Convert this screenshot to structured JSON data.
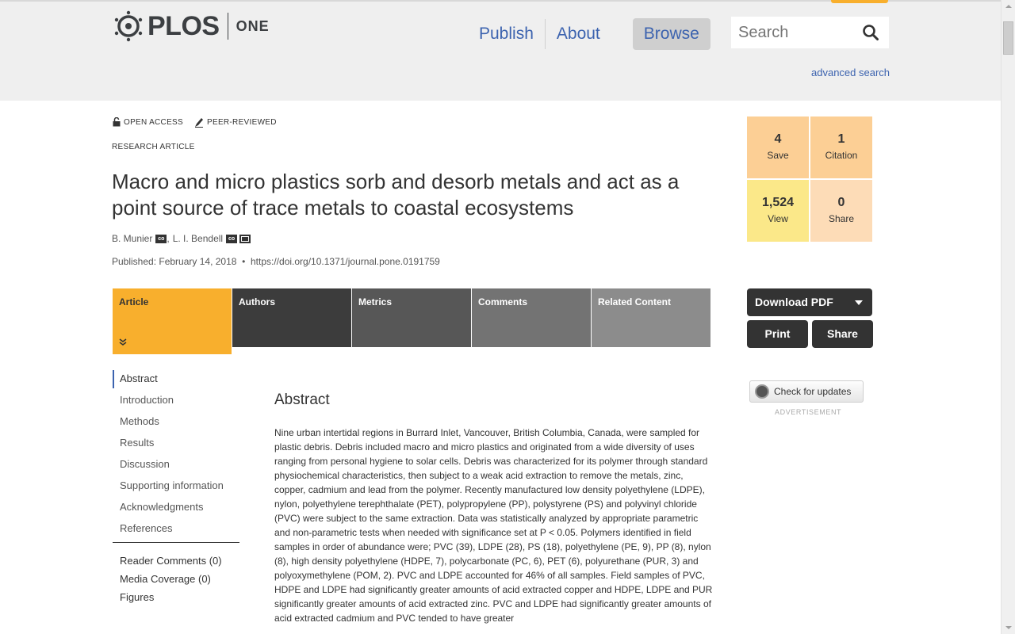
{
  "header": {
    "logo_text": "PLOS",
    "logo_sub": "ONE",
    "nav": [
      {
        "label": "Publish"
      },
      {
        "label": "About"
      },
      {
        "label": "Browse"
      }
    ],
    "search_placeholder": "Search",
    "advanced_search": "advanced search"
  },
  "article": {
    "badges": {
      "open_access": "OPEN ACCESS",
      "peer_reviewed": "PEER-REVIEWED"
    },
    "type": "RESEARCH ARTICLE",
    "title": "Macro and micro plastics sorb and desorb metals and act as a point source of trace metals to coastal ecosystems",
    "authors": [
      {
        "name": "B. Munier"
      },
      {
        "name": "L. I. Bendell"
      }
    ],
    "author_badge": "co",
    "published": "Published: February 14, 2018",
    "doi": "https://doi.org/10.1371/journal.pone.0191759"
  },
  "metrics": {
    "save": {
      "value": "4",
      "label": "Save"
    },
    "citation": {
      "value": "1",
      "label": "Citation"
    },
    "view": {
      "value": "1,524",
      "label": "View"
    },
    "share": {
      "value": "0",
      "label": "Share"
    }
  },
  "tabs": [
    {
      "label": "Article"
    },
    {
      "label": "Authors"
    },
    {
      "label": "Metrics"
    },
    {
      "label": "Comments"
    },
    {
      "label": "Related Content"
    }
  ],
  "actions": {
    "download": "Download PDF",
    "print": "Print",
    "share": "Share",
    "check_updates": "Check for updates",
    "advertisement": "ADVERTISEMENT"
  },
  "sidenav": {
    "sections": [
      "Abstract",
      "Introduction",
      "Methods",
      "Results",
      "Discussion",
      "Supporting information",
      "Acknowledgments",
      "References"
    ],
    "extras": [
      "Reader Comments (0)",
      "Media Coverage (0)",
      "Figures"
    ]
  },
  "abstract": {
    "heading": "Abstract",
    "text": "Nine urban intertidal regions in Burrard Inlet, Vancouver, British Columbia, Canada, were sampled for plastic debris. Debris included macro and micro plastics and originated from a wide diversity of uses ranging from personal hygiene to solar cells. Debris was characterized for its polymer through standard physiochemical characteristics, then subject to a weak acid extraction to remove the metals, zinc, copper, cadmium and lead from the polymer. Recently manufactured low density polyethylene (LDPE), nylon, polyethylene terephthalate (PET), polypropylene (PP), polystyrene (PS) and polyvinyl chloride (PVC) were subject to the same extraction. Data was statistically analyzed by appropriate parametric and non-parametric tests when needed with significance set at P < 0.05. Polymers identified in field samples in order of abundance were; PVC (39), LDPE (28), PS (18), polyethylene (PE, 9), PP (8), nylon (8), high density polyethylene (HDPE, 7), polycarbonate (PC, 6), PET (6), polyurethane (PUR, 3) and polyoxymethylene (POM, 2). PVC and LDPE accounted for 46% of all samples. Field samples of PVC, HDPE and LDPE had significantly greater amounts of acid extracted copper and HDPE, LDPE and PUR significantly greater amounts of acid extracted zinc. PVC and LDPE had significantly greater amounts of acid extracted cadmium and PVC tended to have greater"
  },
  "colors": {
    "accent": "#f8af2d",
    "link": "#3c63af",
    "save_bg": "#fccf95",
    "view_bg": "#fbe889",
    "share_bg": "#fddcb7"
  }
}
